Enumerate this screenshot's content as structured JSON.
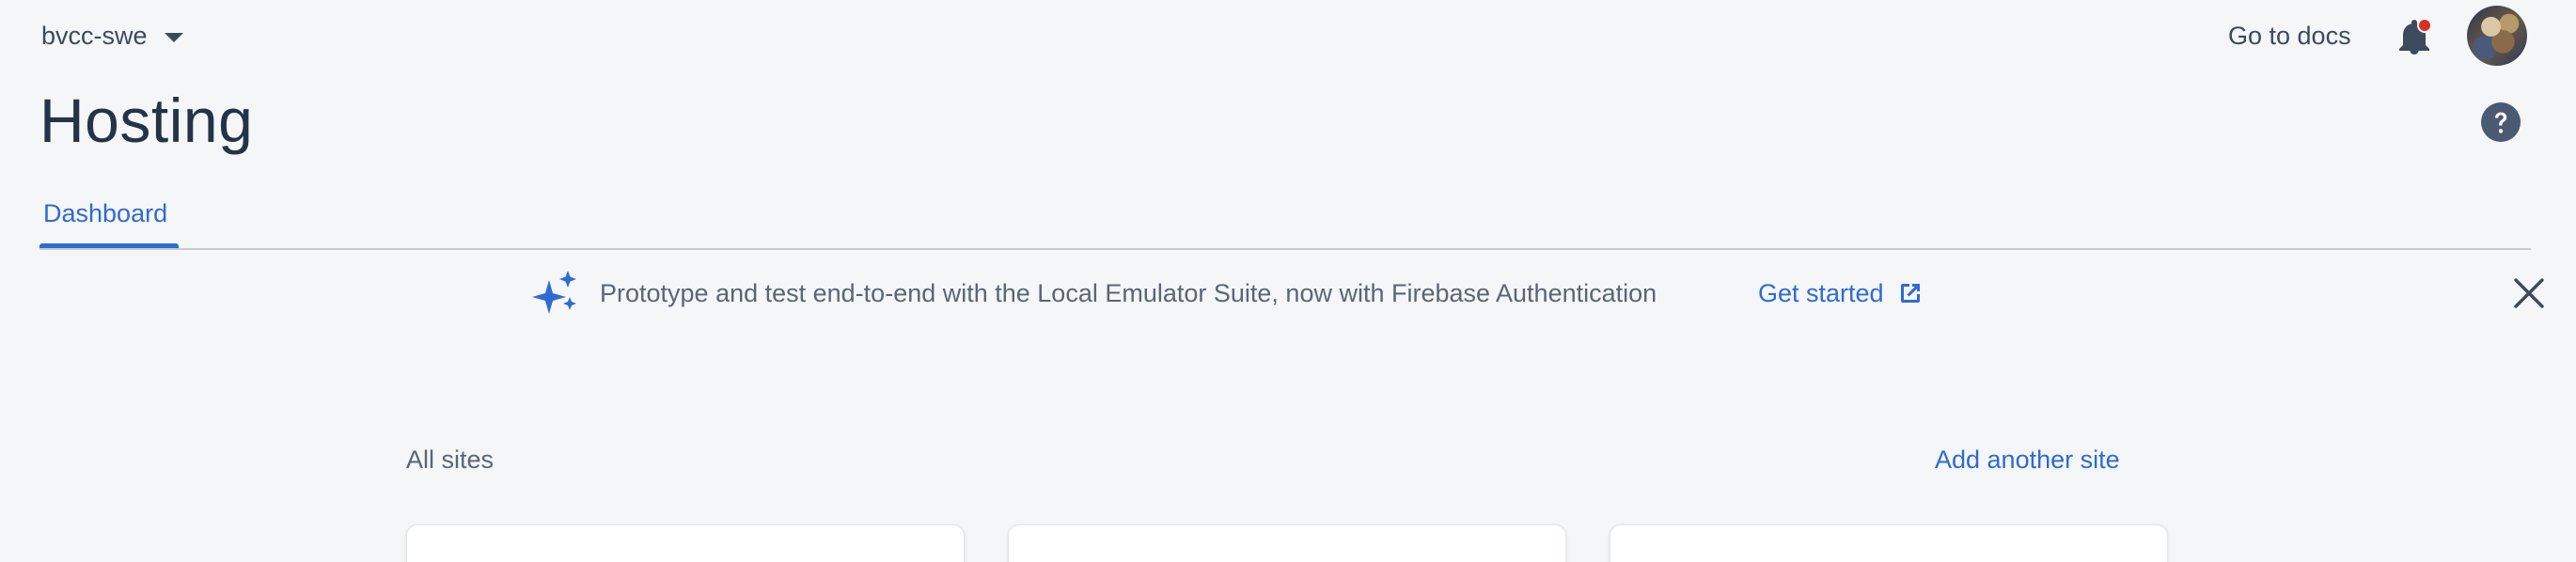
{
  "header": {
    "project_name": "bvcc-swe",
    "docs_link": "Go to docs"
  },
  "page": {
    "title": "Hosting"
  },
  "tabs": [
    {
      "label": "Dashboard",
      "active": true
    }
  ],
  "banner": {
    "text": "Prototype and test end-to-end with the Local Emulator Suite, now with Firebase Authentication",
    "action_label": "Get started"
  },
  "sites": {
    "section_label": "All sites",
    "add_label": "Add another site",
    "cards": [
      {},
      {},
      {}
    ]
  },
  "colors": {
    "accent": "#2f6ad0",
    "background": "#f5f6f8",
    "title": "#243347",
    "notification_dot": "#d93025"
  },
  "icons": {
    "project_caret": "chevron-down-icon",
    "notifications": "bell-icon",
    "help": "help-icon",
    "banner": "sparkle-icon",
    "external": "open-in-new-icon",
    "dismiss": "close-icon"
  }
}
